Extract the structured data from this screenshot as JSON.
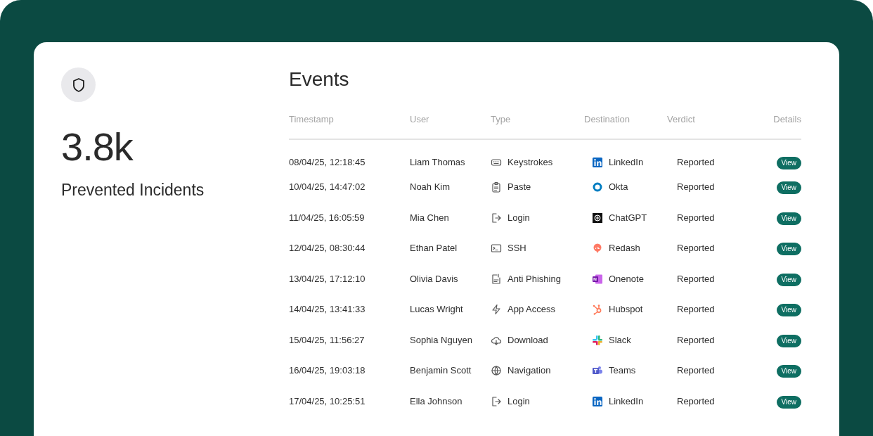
{
  "summary": {
    "value": "3.8k",
    "label": "Prevented Incidents"
  },
  "events": {
    "title": "Events",
    "columns": [
      "Timestamp",
      "User",
      "Type",
      "Destination",
      "Verdict",
      "Details"
    ],
    "rows": [
      {
        "timestamp": "08/04/25, 12:18:45",
        "user": "Liam Thomas",
        "type": {
          "label": "Keystrokes",
          "kind": "keyboard"
        },
        "destination": {
          "label": "LinkedIn",
          "kind": "linkedin"
        },
        "verdict": "Reported",
        "action": "View"
      },
      {
        "timestamp": "10/04/25, 14:47:02",
        "user": "Noah Kim",
        "type": {
          "label": "Paste",
          "kind": "clipboard"
        },
        "destination": {
          "label": "Okta",
          "kind": "okta"
        },
        "verdict": "Reported",
        "action": "View"
      },
      {
        "timestamp": "11/04/25, 16:05:59",
        "user": "Mia Chen",
        "type": {
          "label": "Login",
          "kind": "login"
        },
        "destination": {
          "label": "ChatGPT",
          "kind": "chatgpt"
        },
        "verdict": "Reported",
        "action": "View"
      },
      {
        "timestamp": "12/04/25, 08:30:44",
        "user": "Ethan Patel",
        "type": {
          "label": "SSH",
          "kind": "terminal"
        },
        "destination": {
          "label": "Redash",
          "kind": "redash"
        },
        "verdict": "Reported",
        "action": "View"
      },
      {
        "timestamp": "13/04/25, 17:12:10",
        "user": "Olivia Davis",
        "type": {
          "label": "Anti Phishing",
          "kind": "document"
        },
        "destination": {
          "label": "Onenote",
          "kind": "onenote"
        },
        "verdict": "Reported",
        "action": "View"
      },
      {
        "timestamp": "14/04/25, 13:41:33",
        "user": "Lucas Wright",
        "type": {
          "label": "App Access",
          "kind": "bolt"
        },
        "destination": {
          "label": "Hubspot",
          "kind": "hubspot"
        },
        "verdict": "Reported",
        "action": "View"
      },
      {
        "timestamp": "15/04/25, 11:56:27",
        "user": "Sophia Nguyen",
        "type": {
          "label": "Download",
          "kind": "cloud"
        },
        "destination": {
          "label": "Slack",
          "kind": "slack"
        },
        "verdict": "Reported",
        "action": "View"
      },
      {
        "timestamp": "16/04/25, 19:03:18",
        "user": "Benjamin Scott",
        "type": {
          "label": "Navigation",
          "kind": "globe"
        },
        "destination": {
          "label": "Teams",
          "kind": "teams"
        },
        "verdict": "Reported",
        "action": "View"
      },
      {
        "timestamp": "17/04/25, 10:25:51",
        "user": "Ella Johnson",
        "type": {
          "label": "Login",
          "kind": "login"
        },
        "destination": {
          "label": "LinkedIn",
          "kind": "linkedin"
        },
        "verdict": "Reported",
        "action": "View"
      }
    ]
  }
}
